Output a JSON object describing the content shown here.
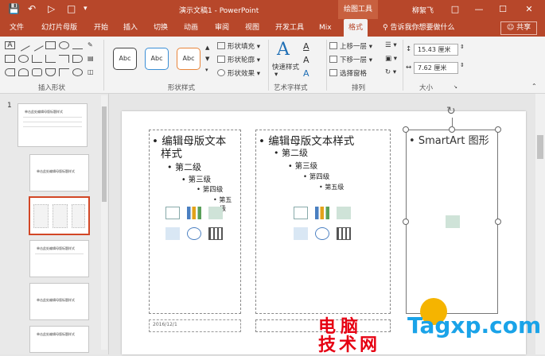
{
  "titlebar": {
    "title": "演示文稿1  -  PowerPoint",
    "context_tool": "绘图工具",
    "user": "柳絮飞",
    "bg_color": "#b7472a"
  },
  "tabs": [
    "文件",
    "幻灯片母版",
    "开始",
    "插入",
    "切换",
    "动画",
    "审阅",
    "视图",
    "开发工具",
    "Mix",
    "格式"
  ],
  "tell_me": "告诉我你想要做什么",
  "share": "共享",
  "ribbon": {
    "groups": {
      "insert_shapes": "插入形状",
      "shape_styles": "形状样式",
      "wordart": "艺术字样式",
      "arrange": "排列",
      "size": "大小"
    },
    "style_sample": "Abc",
    "shape_fill": "形状填充",
    "shape_outline": "形状轮廓",
    "shape_effects": "形状效果",
    "quick_styles": "快速样式",
    "bring_forward": "上移一层",
    "send_backward": "下移一层",
    "selection_pane": "选择窗格",
    "height": "15.43 厘米",
    "width": "7.62 厘米"
  },
  "slide_panel": {
    "number": "1",
    "thumb_title": "单击此处编辑母版标题样式"
  },
  "slide": {
    "left_ph": [
      "编辑母版文本",
      "样式",
      "第二级",
      "第三级",
      "第四级",
      "第五",
      "级"
    ],
    "mid_ph": [
      "编辑母版文本样式",
      "第二级",
      "第三级",
      "第四级",
      "第五级"
    ],
    "right_ph": "SmartArt 图形",
    "date": "2016/12/1"
  },
  "watermark": {
    "line1": "电脑",
    "line2": "技术网",
    "site": "Tagxp.com"
  },
  "colors": {
    "accent": "#b7472a",
    "selected_thumb_border": "#d24726",
    "watermark_red": "#e60012",
    "watermark_blue": "#1aa3e8"
  }
}
